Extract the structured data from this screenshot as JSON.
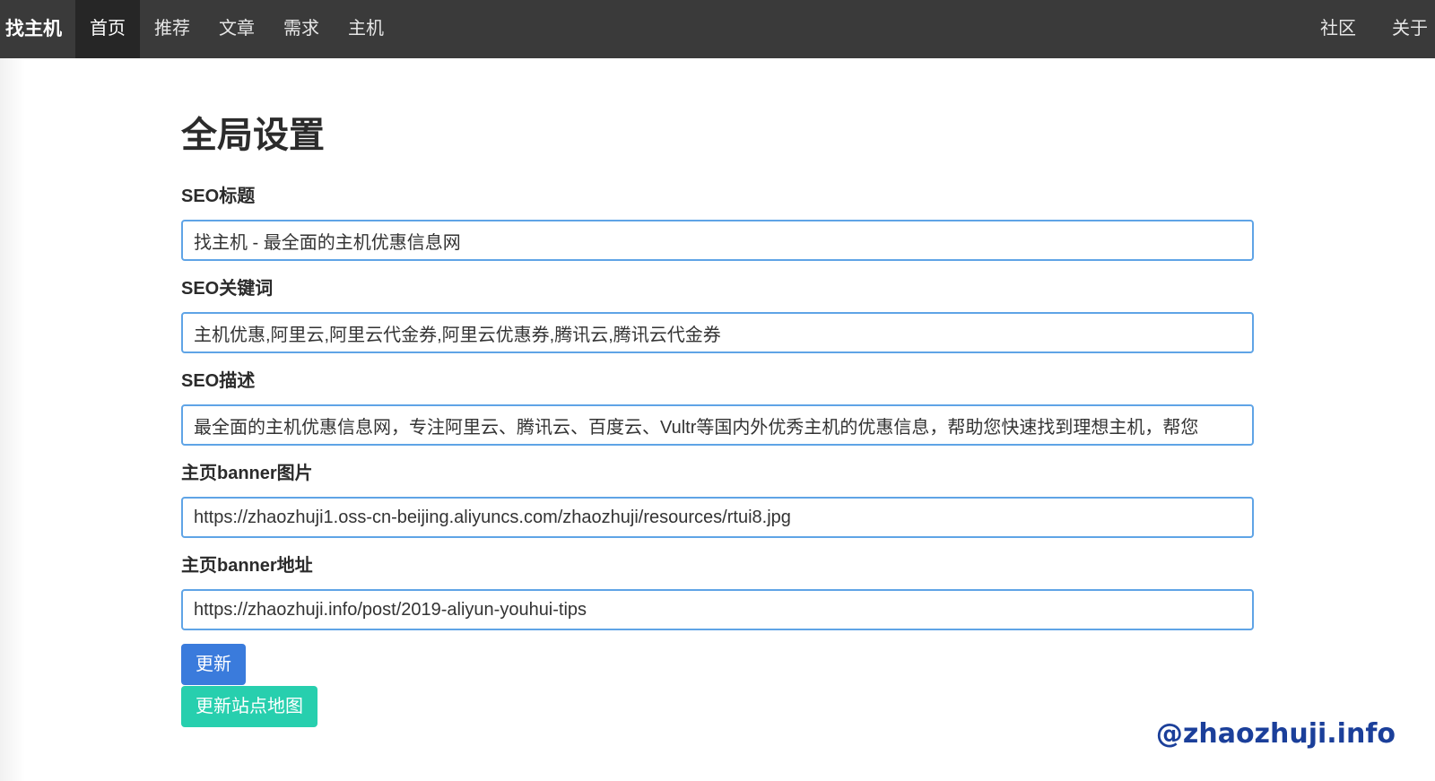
{
  "navbar": {
    "brand": "找主机",
    "left_items": [
      {
        "label": "首页",
        "active": true
      },
      {
        "label": "推荐",
        "active": false
      },
      {
        "label": "文章",
        "active": false
      },
      {
        "label": "需求",
        "active": false
      },
      {
        "label": "主机",
        "active": false
      }
    ],
    "right_items": [
      {
        "label": "社区"
      },
      {
        "label": "关于"
      }
    ]
  },
  "page": {
    "title": "全局设置"
  },
  "form": {
    "seo_title": {
      "label": "SEO标题",
      "value": "找主机 - 最全面的主机优惠信息网"
    },
    "seo_keywords": {
      "label": "SEO关键词",
      "value": "主机优惠,阿里云,阿里云代金券,阿里云优惠券,腾讯云,腾讯云代金券"
    },
    "seo_description": {
      "label": "SEO描述",
      "value": "最全面的主机优惠信息网，专注阿里云、腾讯云、百度云、Vultr等国内外优秀主机的优惠信息，帮助您快速找到理想主机，帮您"
    },
    "banner_image": {
      "label": "主页banner图片",
      "value": "https://zhaozhuji1.oss-cn-beijing.aliyuncs.com/zhaozhuji/resources/rtui8.jpg"
    },
    "banner_link": {
      "label": "主页banner地址",
      "value": "https://zhaozhuji.info/post/2019-aliyun-youhui-tips"
    },
    "update_label": "更新",
    "sitemap_label": "更新站点地图"
  },
  "watermark": "@zhaozhuji.info",
  "colors": {
    "navbar_bg": "#3a3a3a",
    "input_border": "#5fa4e6",
    "primary": "#3a7bdc",
    "success": "#27cfae",
    "watermark": "#1b3f9a"
  }
}
